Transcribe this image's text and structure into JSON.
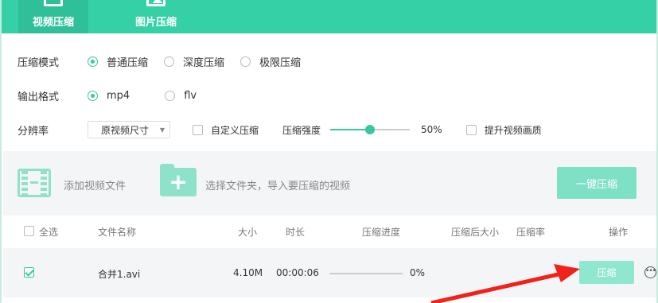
{
  "tabs": [
    {
      "label": "视频压缩",
      "icon": "video-tab-icon",
      "active": true
    },
    {
      "label": "图片压缩",
      "icon": "image-tab-icon",
      "active": false
    }
  ],
  "settings": {
    "mode_label": "压缩模式",
    "mode_options": [
      "普通压缩",
      "深度压缩",
      "极限压缩"
    ],
    "mode_selected": "普通压缩",
    "format_label": "输出格式",
    "format_options": [
      "mp4",
      "flv"
    ],
    "format_selected": "mp4",
    "resolution_label": "分辨率",
    "resolution_value": "原视频尺寸",
    "custom_label": "自定义压缩",
    "strength_label": "压缩强度",
    "strength_value": "50%",
    "strength_fraction": 0.5,
    "enhance_label": "提升视频画质"
  },
  "addbar": {
    "add_file": "添加视频文件",
    "add_folder": "选择文件夹，导入要压缩的视频",
    "compress_all": "一键压缩"
  },
  "table": {
    "headers": {
      "select_all": "全选",
      "name": "文件名称",
      "size": "大小",
      "duration": "时长",
      "progress": "压缩进度",
      "after_size": "压缩后大小",
      "ratio": "压缩率",
      "action": "操作"
    },
    "rows": [
      {
        "checked": true,
        "name": "合并1.avi",
        "size": "4.10M",
        "duration": "00:00:06",
        "progress": "0%",
        "action": "压缩"
      }
    ]
  },
  "colors": {
    "accent": "#35d0a6",
    "button": "#7ee0c4",
    "arrow": "#f0221a"
  }
}
